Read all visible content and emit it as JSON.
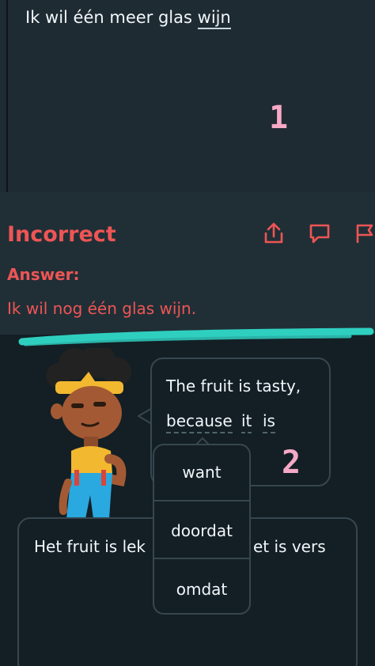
{
  "top": {
    "prompt_prefix": "Ik wil één meer glas ",
    "prompt_highlight": "wijn",
    "marker": "1"
  },
  "result": {
    "title": "Incorrect",
    "answer_label": "Answer:",
    "answer_text": "Ik wil nog één glas wijn.",
    "icons": [
      "share-icon",
      "comment-icon",
      "flag-icon"
    ],
    "color": "#ee5555"
  },
  "exercise": {
    "bubble_line1": "The fruit is tasty,",
    "bubble_word1": "because",
    "bubble_word2": "it",
    "bubble_word3": "is",
    "marker": "2",
    "sentence_left": "Het fruit is lek",
    "sentence_right": "et is vers",
    "options": [
      "want",
      "doordat",
      "omdat"
    ]
  },
  "colors": {
    "background": "#131f24",
    "panel": "#202f36",
    "border": "#37464f",
    "marker": "#f6a9c6",
    "swoosh": "#2fcfc0"
  }
}
